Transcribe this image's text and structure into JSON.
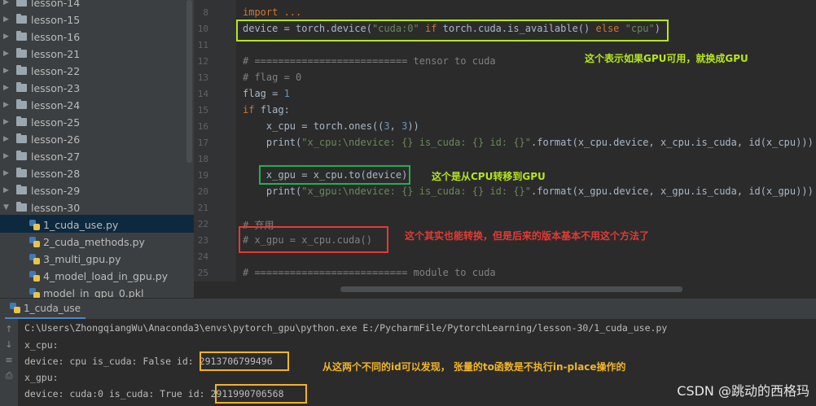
{
  "sidebar": {
    "items": [
      {
        "label": "lesson-14",
        "kind": "folder"
      },
      {
        "label": "lesson-15",
        "kind": "folder"
      },
      {
        "label": "lesson-16",
        "kind": "folder"
      },
      {
        "label": "lesson-21",
        "kind": "folder"
      },
      {
        "label": "lesson-22",
        "kind": "folder"
      },
      {
        "label": "lesson-23",
        "kind": "folder"
      },
      {
        "label": "lesson-24",
        "kind": "folder"
      },
      {
        "label": "lesson-25",
        "kind": "folder"
      },
      {
        "label": "lesson-26",
        "kind": "folder"
      },
      {
        "label": "lesson-27",
        "kind": "folder"
      },
      {
        "label": "lesson-28",
        "kind": "folder"
      },
      {
        "label": "lesson-29",
        "kind": "folder"
      },
      {
        "label": "lesson-30",
        "kind": "folder-open"
      },
      {
        "label": "1_cuda_use.py",
        "kind": "py"
      },
      {
        "label": "2_cuda_methods.py",
        "kind": "py"
      },
      {
        "label": "3_multi_gpu.py",
        "kind": "py"
      },
      {
        "label": "4_model_load_in_gpu.py",
        "kind": "py"
      },
      {
        "label": "model_in_gpu_0.pkl",
        "kind": "py"
      }
    ]
  },
  "editor": {
    "line_numbers": [
      "8",
      "10",
      "11",
      "12",
      "13",
      "14",
      "15",
      "16",
      "17",
      "18",
      "19",
      "20",
      "21",
      "22",
      "23",
      "24",
      "25"
    ],
    "lines": {
      "l8": "import ...",
      "l10_a": "device = torch.device(",
      "l10_b": "\"cuda:0\"",
      "l10_c": " if ",
      "l10_d": "torch.cuda.is_available() ",
      "l10_e": "else ",
      "l10_f": "\"cpu\"",
      "l10_g": ")",
      "l12": "# ========================== tensor to cuda",
      "l13": "# flag = 0",
      "l14_a": "flag = ",
      "l14_b": "1",
      "l15_a": "if ",
      "l15_b": "flag:",
      "l16_a": "    x_cpu = torch.ones((",
      "l16_b": "3",
      "l16_c": ", ",
      "l16_d": "3",
      "l16_e": "))",
      "l17_a": "    print(",
      "l17_b": "\"x_cpu:\\ndevice: {} is_cuda: {} id: {}\"",
      "l17_c": ".format(x_cpu.device, x_cpu.is_cuda, id(x_cpu)))",
      "l19": "    x_gpu = x_cpu.to(device)",
      "l20_a": "    print(",
      "l20_b": "\"x_gpu:\\ndevice: {} is_cuda: {} id: {}\"",
      "l20_c": ".format(x_gpu.device, x_gpu.is_cuda, id(x_gpu)))",
      "l22": "# 弃用",
      "l23": "# x_gpu = x_cpu.cuda()",
      "l25": "# ========================== module to cuda"
    }
  },
  "annotations": {
    "note1": "这个表示如果GPU可用，就换成GPU",
    "note2": "这个是从CPU转移到GPU",
    "note3": "这个其实也能转换，但是后来的版本基本不用这个方法了",
    "note4": "从这两个不同的id可以发现， 张量的to函数是不执行in-place操作的",
    "colors": {
      "green": "#b5e61d",
      "green2": "#22b14c",
      "red": "#e53935",
      "yellow": "#f0b429"
    }
  },
  "run": {
    "tab_label": "1_cuda_use",
    "console": {
      "cmd": "C:\\Users\\ZhongqiangWu\\Anaconda3\\envs\\pytorch_gpu\\python.exe E:/PycharmFile/PytorchLearning/lesson-30/1_cuda_use.py",
      "l1": "x_cpu:",
      "l2_a": "device: cpu is_cuda: False id: ",
      "l2_b": "2913706799496",
      "l3": "x_gpu:",
      "l4_a": "device: cuda:0 is_cuda: True id: ",
      "l4_b": "2911990706568"
    }
  },
  "watermark": "CSDN @跳动的西格玛"
}
